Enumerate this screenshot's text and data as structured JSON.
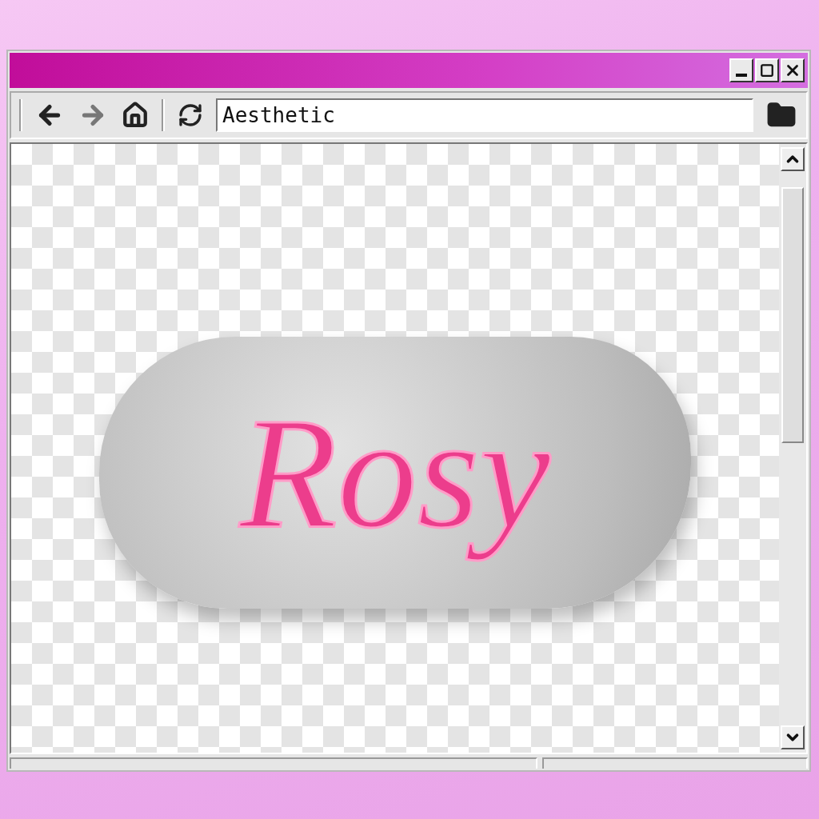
{
  "window": {
    "address": "Aesthetic"
  },
  "artwork": {
    "text": "Rosy"
  }
}
